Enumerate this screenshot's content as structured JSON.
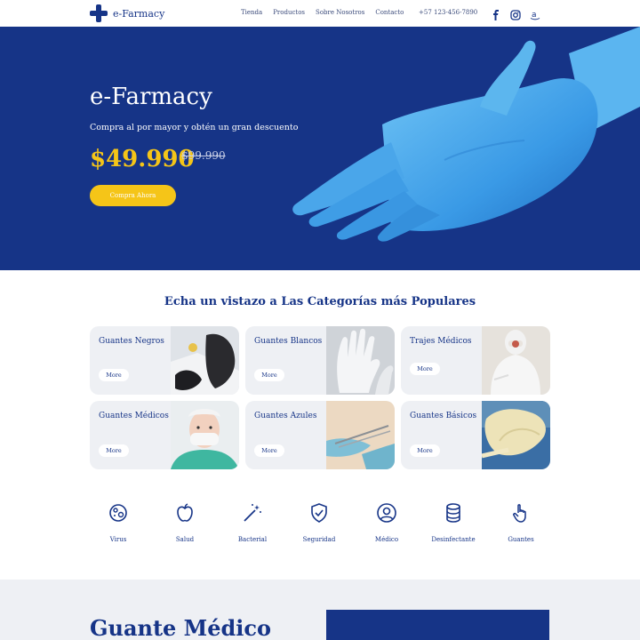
{
  "nav": {
    "logo_text": "e-Farmacy",
    "links": [
      "Tienda",
      "Productos",
      "Sobre Nosotros",
      "Contacto"
    ],
    "phone": "+57 123-456-7890",
    "social": [
      "facebook-icon",
      "instagram-icon",
      "amazon-icon"
    ]
  },
  "hero": {
    "title": "e-Farmacy",
    "subtitle": "Compra al por mayor y obtén un gran descuento",
    "price": "$49.990",
    "old_price": "$99.990",
    "cta": "Compra Ahora"
  },
  "categories": {
    "title": "Echa un vistazo a Las Categorías más Populares",
    "more_label": "More",
    "items": [
      {
        "name": "Guantes Negros"
      },
      {
        "name": "Guantes Blancos"
      },
      {
        "name": "Trajes Médicos"
      },
      {
        "name": "Guantes Médicos"
      },
      {
        "name": "Guantes Azules"
      },
      {
        "name": "Guantes Básicos"
      }
    ]
  },
  "features": [
    {
      "label": "Virus",
      "icon": "virus-icon"
    },
    {
      "label": "Salud",
      "icon": "apple-icon"
    },
    {
      "label": "Bacterial",
      "icon": "magic-wand-icon"
    },
    {
      "label": "Seguridad",
      "icon": "shield-check-icon"
    },
    {
      "label": "Médico",
      "icon": "user-circle-icon"
    },
    {
      "label": "Desinfectante",
      "icon": "database-icon"
    },
    {
      "label": "Guantes",
      "icon": "hand-pointer-icon"
    }
  ],
  "bottom": {
    "title": "Guante Médico"
  },
  "colors": {
    "brand_blue": "#163487",
    "accent_yellow": "#f5c518",
    "card_bg": "#eef0f4"
  }
}
